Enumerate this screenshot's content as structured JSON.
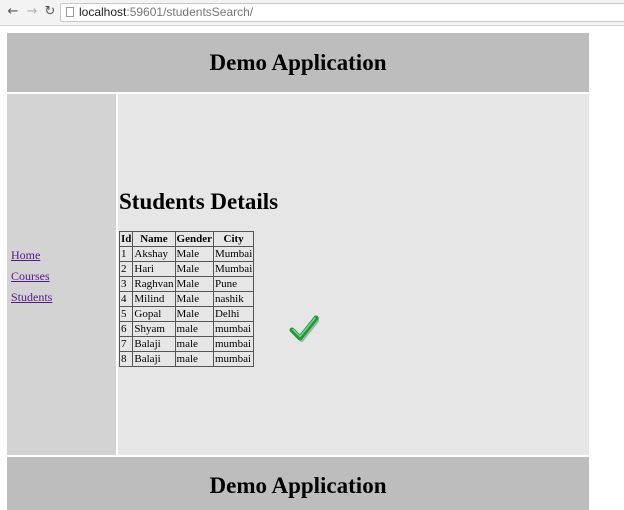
{
  "browser": {
    "back_icon": "arrow-left-icon",
    "forward_icon": "arrow-right-icon",
    "reload_icon": "reload-icon",
    "url_host": "localhost",
    "url_rest": ":59601/studentsSearch/"
  },
  "header": {
    "title": "Demo Application"
  },
  "sidebar": {
    "links": [
      {
        "label": "Home"
      },
      {
        "label": "Courses"
      },
      {
        "label": "Students"
      }
    ]
  },
  "main": {
    "heading": "Students Details",
    "table": {
      "columns": [
        "Id",
        "Name",
        "Gender",
        "City"
      ],
      "rows": [
        [
          "1",
          "Akshay",
          "Male",
          "Mumbai"
        ],
        [
          "2",
          "Hari",
          "Male",
          "Mumbai"
        ],
        [
          "3",
          "Raghvan",
          "Male",
          "Pune"
        ],
        [
          "4",
          "Milind",
          "Male",
          "nashik"
        ],
        [
          "5",
          "Gopal",
          "Male",
          "Delhi"
        ],
        [
          "6",
          "Shyam",
          "male",
          "mumbai"
        ],
        [
          "7",
          "Balaji",
          "male",
          "mumbai"
        ],
        [
          "8",
          "Balaji",
          "male",
          "mumbai"
        ]
      ]
    },
    "overlay_icon": "checkmark-icon"
  },
  "footer": {
    "title": "Demo Application"
  },
  "colors": {
    "header_bg": "#bdbdbd",
    "sidebar_bg": "#d3d3d3",
    "content_bg": "#e6e6e6",
    "link": "#551a8b",
    "check": "#1f9a3a"
  }
}
